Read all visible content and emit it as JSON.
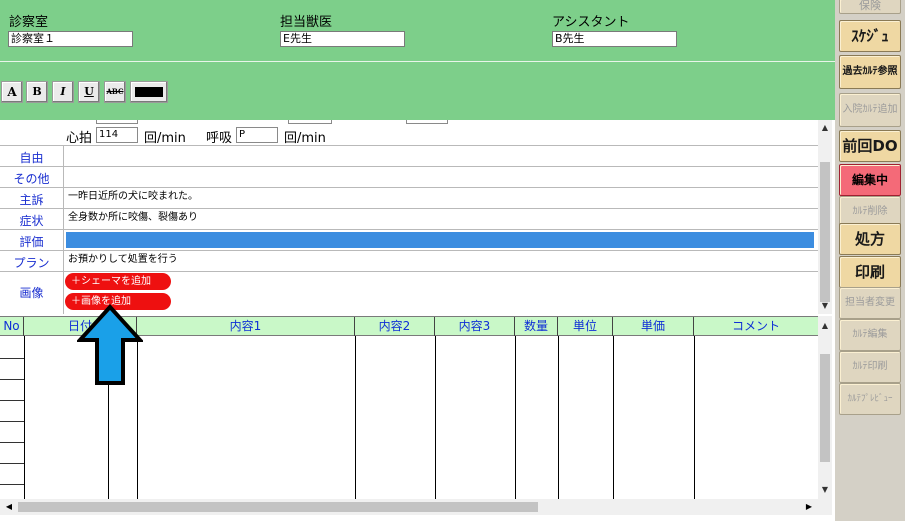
{
  "header": {
    "room_label": "診察室",
    "room_value": "診察室１",
    "vet_label": "担当獣医",
    "vet_value": "E先生",
    "assistant_label": "アシスタント",
    "assistant_value": "B先生"
  },
  "toolbar": {
    "font_size_label": "A",
    "bold_label": "B",
    "italic_label": "I",
    "underline_label": "U",
    "strike_label": "ABC",
    "color_value": "#000000"
  },
  "vitals": {
    "pulse_label": "心拍",
    "pulse_value": "114",
    "pulse_unit": "回/min",
    "resp_label": "呼吸",
    "resp_value": "P",
    "resp_unit": "回/min"
  },
  "soap": {
    "rows": [
      {
        "label": "自由",
        "value": ""
      },
      {
        "label": "その他",
        "value": ""
      },
      {
        "label": "主訴",
        "value": "一昨日近所の犬に咬まれた。"
      },
      {
        "label": "症状",
        "value": "全身数か所に咬傷、裂傷あり"
      },
      {
        "label": "評価",
        "value": ""
      },
      {
        "label": "プラン",
        "value": "お預かりして処置を行う"
      },
      {
        "label": "画像",
        "value": ""
      }
    ],
    "add_schema_label": "＋シェーマを追加",
    "add_image_label": "＋画像を追加"
  },
  "grid": {
    "headers": [
      "No",
      "日付",
      "内容1",
      "内容2",
      "内容3",
      "数量",
      "単位",
      "単価",
      "コメント"
    ]
  },
  "sidebar": {
    "buttons": [
      {
        "label": "保険",
        "state": "disabled"
      },
      {
        "label": "ｽｹｼﾞｭ",
        "state": "normal"
      },
      {
        "label": "過去ｶﾙﾃ参照",
        "state": "normal"
      },
      {
        "label": "入院ｶﾙﾃ追加",
        "state": "disabled"
      },
      {
        "label": "前回DO",
        "state": "normal"
      },
      {
        "label": "編集中",
        "state": "active"
      },
      {
        "label": "ｶﾙﾃ削除",
        "state": "disabled"
      },
      {
        "label": "処方",
        "state": "normal"
      },
      {
        "label": "印刷",
        "state": "normal"
      },
      {
        "label": "担当者変更",
        "state": "disabled"
      },
      {
        "label": "ｶﾙﾃ編集",
        "state": "disabled"
      },
      {
        "label": "ｶﾙﾃ印刷",
        "state": "disabled"
      },
      {
        "label": "ｶﾙﾃﾌﾟﾚﾋﾞｭｰ",
        "state": "disabled"
      }
    ]
  },
  "colors": {
    "header_green": "#7dcf8a",
    "label_blue": "#1a2fd0",
    "selected_row": "#3c8de0",
    "red_button": "#ee1010",
    "arrow_fill": "#1aa0e8",
    "grid_header": "#c9f8c8",
    "active_button": "#f46a78"
  },
  "icons": {
    "arrow": "up-arrow-icon"
  }
}
